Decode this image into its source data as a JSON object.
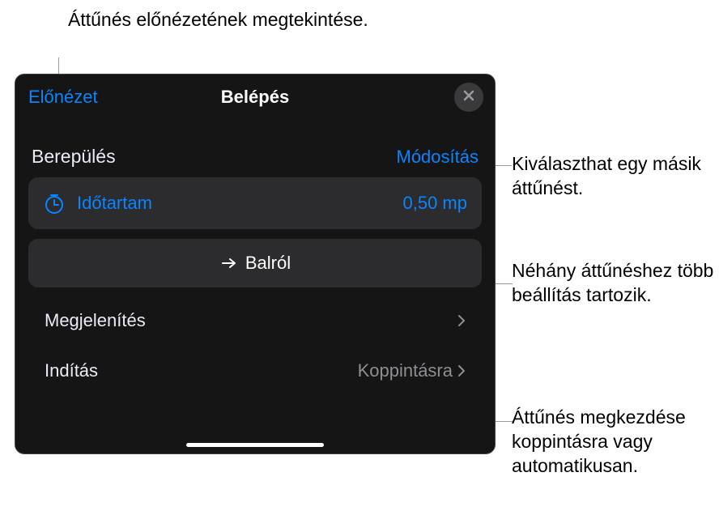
{
  "callouts": {
    "top": "Áttűnés előnézetének megtekintése.",
    "right1": "Kiválaszthat egy másik áttűnést.",
    "right2": "Néhány áttűnéshez több beállítás tartozik.",
    "right3": "Áttűnés megkezdése koppintásra vagy automatikusan."
  },
  "header": {
    "preview": "Előnézet",
    "title": "Belépés"
  },
  "section": {
    "title": "Berepülés",
    "modify": "Módosítás"
  },
  "duration": {
    "label": "Időtartam",
    "value": "0,50 mp"
  },
  "direction": {
    "label": "Balról"
  },
  "appearance": {
    "label": "Megjelenítés"
  },
  "start": {
    "label": "Indítás",
    "value": "Koppintásra"
  }
}
